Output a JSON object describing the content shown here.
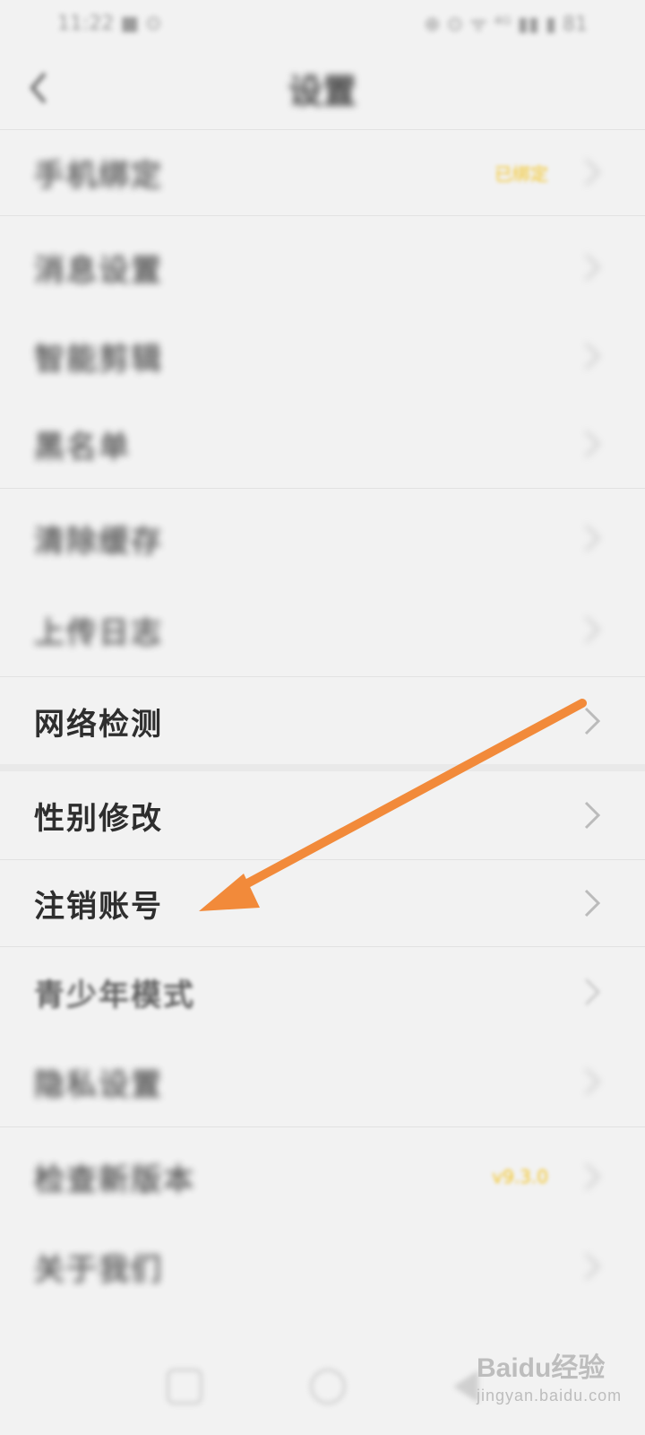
{
  "status_bar": {
    "left": "11:22 ■ ⊙",
    "right": "⊕ ⊙ ᯤ ⁴ᴳ ▮▮ ▮ 81"
  },
  "header": {
    "title": "设置",
    "back_icon": "chevron-left-icon"
  },
  "settings": {
    "items": [
      {
        "label": "手机绑定",
        "badge": "已绑定"
      },
      {
        "label": "消息设置",
        "badge": ""
      },
      {
        "label": "智能剪辑",
        "badge": ""
      },
      {
        "label": "黑名单",
        "badge": ""
      },
      {
        "label": "清除缓存",
        "badge": ""
      },
      {
        "label": "上传日志",
        "badge": ""
      },
      {
        "label": "网络检测",
        "badge": ""
      },
      {
        "label": "性别修改",
        "badge": ""
      },
      {
        "label": "注销账号",
        "badge": ""
      },
      {
        "label": "青少年模式",
        "badge": ""
      },
      {
        "label": "隐私设置",
        "badge": ""
      },
      {
        "label": "检查新版本",
        "badge": "v9.3.0"
      },
      {
        "label": "关于我们",
        "badge": ""
      }
    ]
  },
  "nav": {
    "icons": [
      "recent-apps-icon",
      "home-icon",
      "back-icon"
    ]
  },
  "watermark": {
    "main": "Baidu经验",
    "sub": "jingyan.baidu.com"
  },
  "colors": {
    "arrow": "#f28a3a",
    "badge": "#f3c321",
    "text": "#2e2e2e",
    "background": "#f2f2f2"
  }
}
